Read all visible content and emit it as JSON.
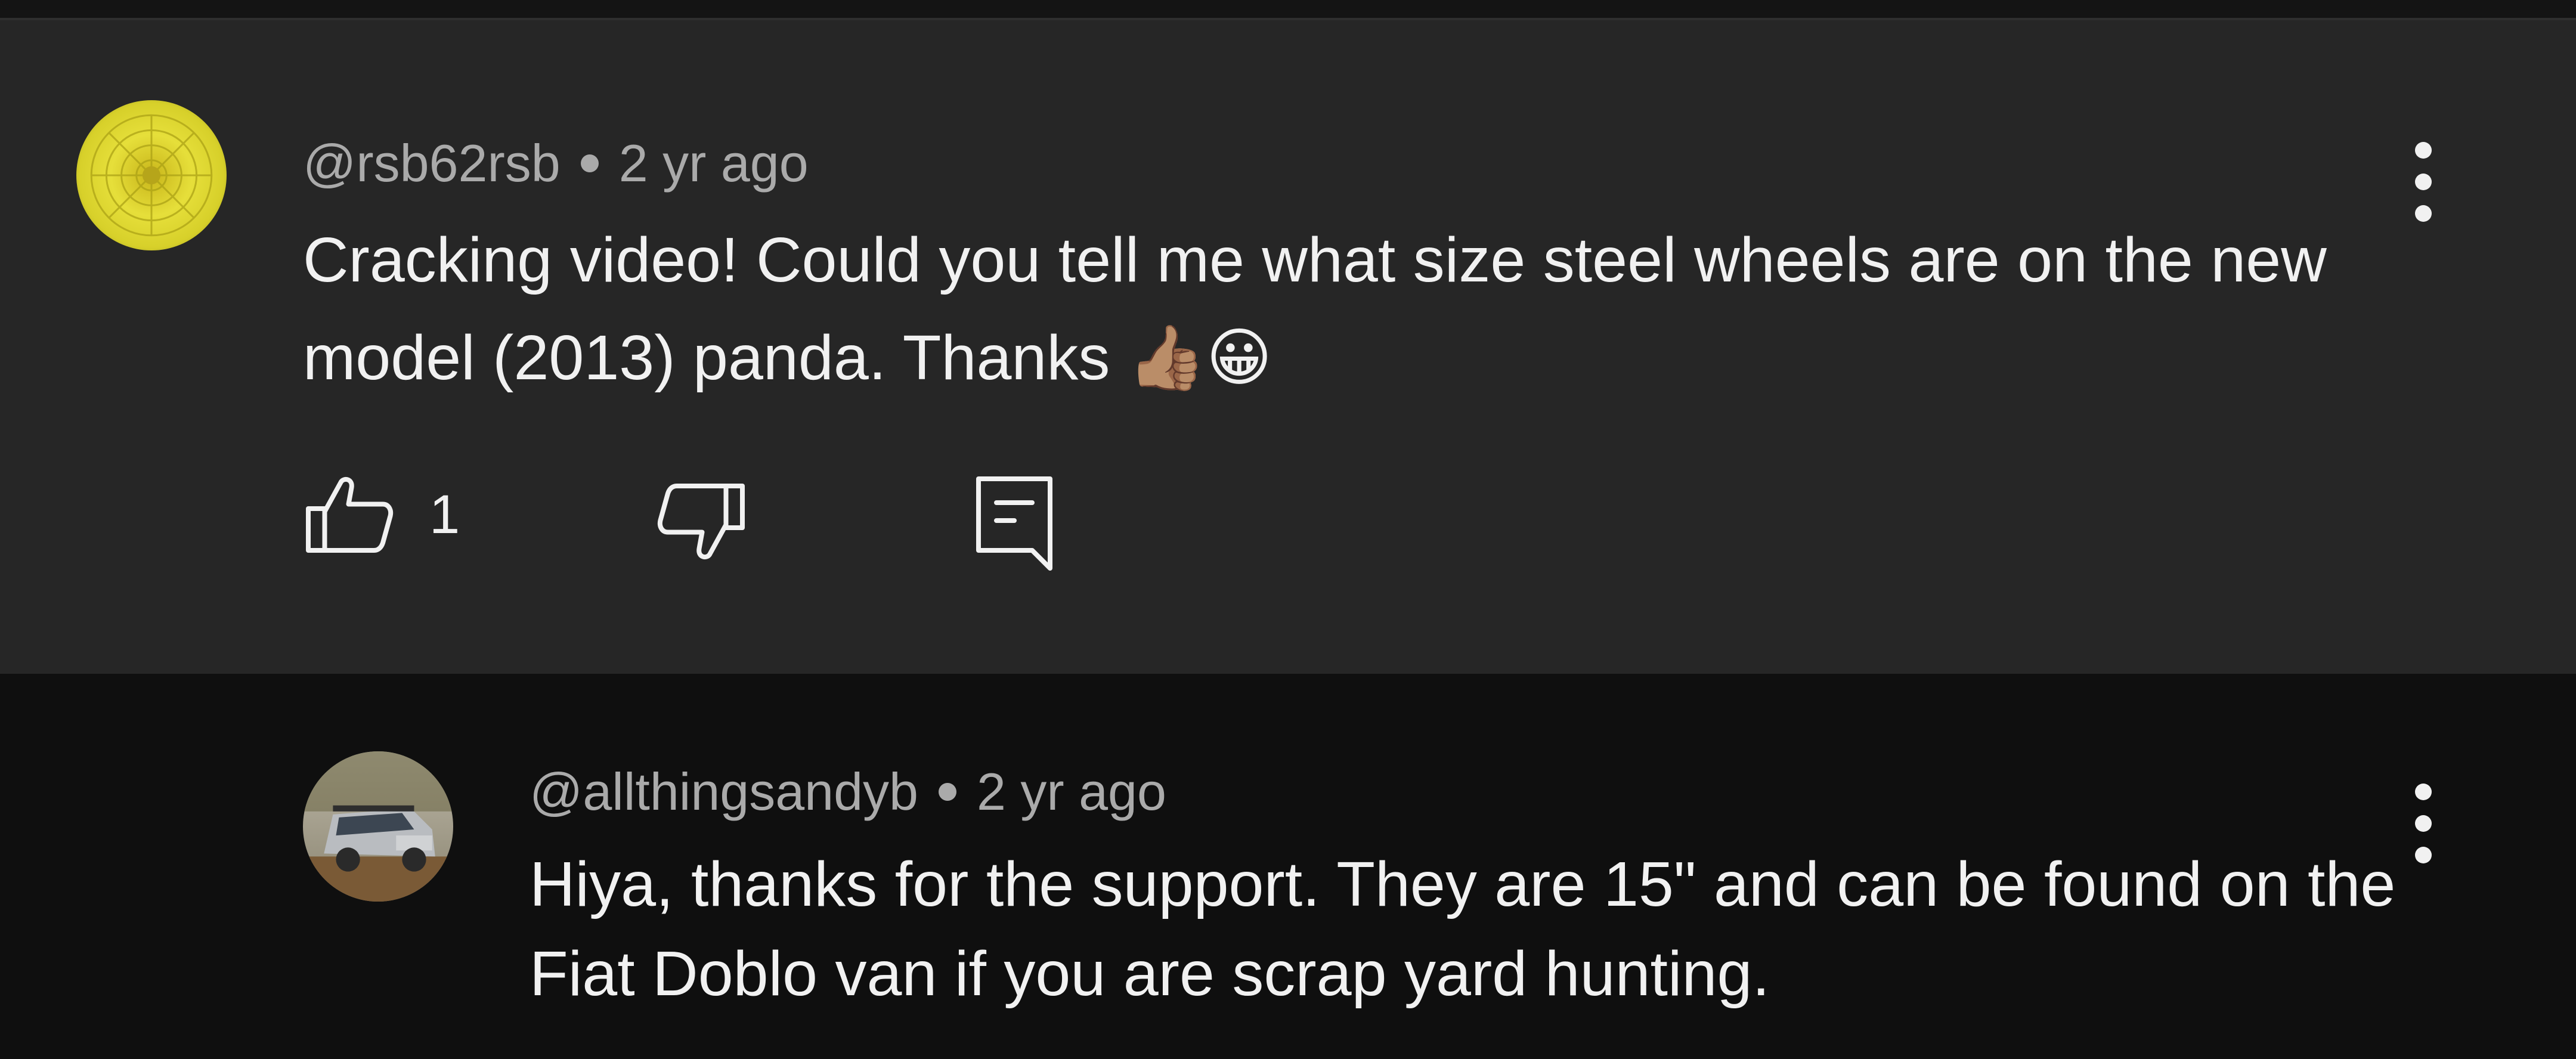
{
  "parent_comment": {
    "avatar": "yellow-flower-avatar",
    "username": "@rsb62rsb",
    "time_ago": "2 yr ago",
    "text": "Cracking video! Could you tell me what size steel wheels are on the new model (2013) panda. Thanks 👍🏽😀",
    "likes": "1",
    "icons": {
      "like": "thumbs-up-icon",
      "dislike": "thumbs-down-icon",
      "reply": "reply-icon",
      "menu": "more-vert-icon"
    }
  },
  "reply_comment": {
    "avatar": "car-photo-avatar",
    "username": "@allthingsandyb",
    "time_ago": "2 yr ago",
    "text": "Hiya, thanks for the support. They are 15\" and can be found on the Fiat Doblo van if you are scrap yard hunting.",
    "icons": {
      "menu": "more-vert-icon"
    }
  },
  "colors": {
    "background": "#0f0f0f",
    "highlight_background": "#262626",
    "primary_text": "#f1f1f1",
    "secondary_text": "#aaaaaa"
  }
}
